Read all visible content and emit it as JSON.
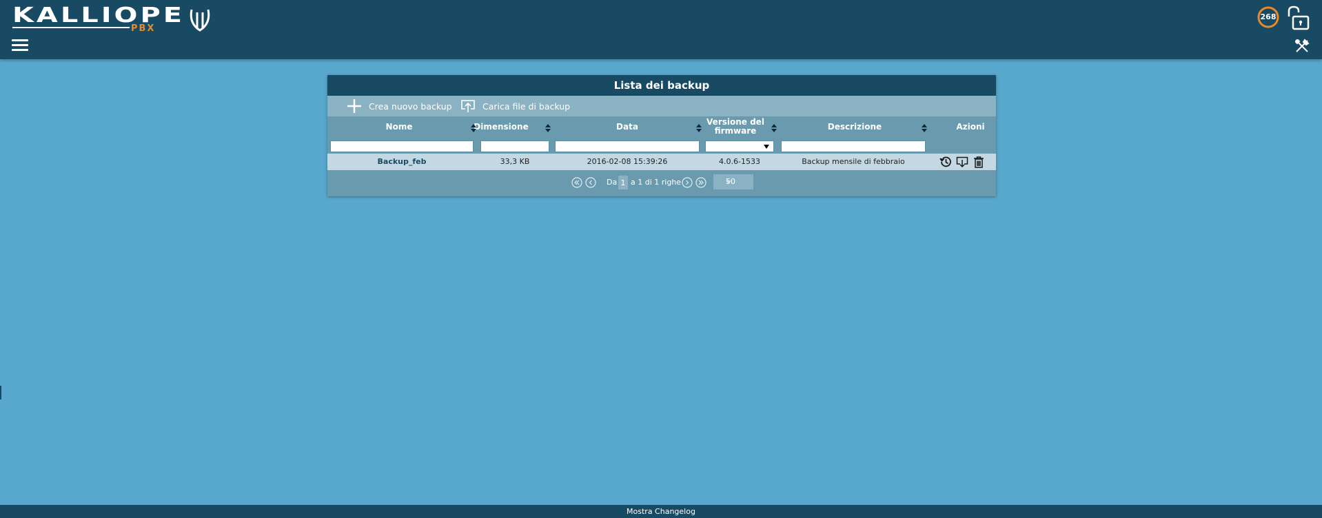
{
  "header": {
    "logo_text": "KALLIOPE",
    "logo_sub": "PBX",
    "counter": "268"
  },
  "panel": {
    "title": "Lista dei backup",
    "toolbar": {
      "new_label": "Crea nuovo backup",
      "upload_label": "Carica file di backup"
    },
    "columns": {
      "name": "Nome",
      "size": "Dimensione",
      "date": "Data",
      "firmware": "Versione del firmware",
      "description": "Descrizione",
      "actions": "Azioni"
    },
    "rows": [
      {
        "name": "Backup_feb",
        "size": "33,3 KB",
        "date": "2016-02-08 15:39:26",
        "firmware": "4.0.6-1533",
        "description": "Backup mensile di febbraio"
      }
    ],
    "pager": {
      "prefix": "Da",
      "page": "1",
      "suffix": "a 1 di 1 righe",
      "page_size": "50"
    }
  },
  "footer": {
    "changelog_label": "Mostra Changelog"
  },
  "colors": {
    "background": "#58a8cd",
    "header": "#194a63",
    "accent": "#e8892b",
    "panel": "#6a9aae",
    "row": "#c3d8e2"
  },
  "icons": [
    "menu-icon",
    "counter-ring",
    "unlock-icon",
    "tools-icon",
    "plus-icon",
    "upload-icon",
    "sort-icon",
    "restore-icon",
    "download-icon",
    "trash-icon",
    "first-page-icon",
    "prev-page-icon",
    "next-page-icon",
    "last-page-icon"
  ]
}
